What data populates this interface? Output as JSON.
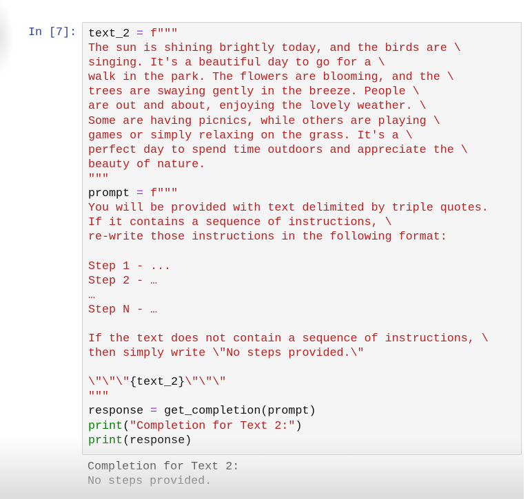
{
  "cell": {
    "prompt": "In [7]:",
    "lines": [
      [
        {
          "t": "text_2 ",
          "c": "n"
        },
        {
          "t": "=",
          "c": "op"
        },
        {
          "t": " f\"\"\"",
          "c": "str"
        }
      ],
      [
        {
          "t": "The sun is shining brightly today, and the birds are \\",
          "c": "str"
        }
      ],
      [
        {
          "t": "singing. It's a beautiful day to go for a \\",
          "c": "str"
        }
      ],
      [
        {
          "t": "walk in the park. The flowers are blooming, and the \\",
          "c": "str"
        }
      ],
      [
        {
          "t": "trees are swaying gently in the breeze. People \\",
          "c": "str"
        }
      ],
      [
        {
          "t": "are out and about, enjoying the lovely weather. \\",
          "c": "str"
        }
      ],
      [
        {
          "t": "Some are having picnics, while others are playing \\",
          "c": "str"
        }
      ],
      [
        {
          "t": "games or simply relaxing on the grass. It's a \\",
          "c": "str"
        }
      ],
      [
        {
          "t": "perfect day to spend time outdoors and appreciate the \\",
          "c": "str"
        }
      ],
      [
        {
          "t": "beauty of nature.",
          "c": "str"
        }
      ],
      [
        {
          "t": "\"\"\"",
          "c": "str"
        }
      ],
      [
        {
          "t": "prompt ",
          "c": "n"
        },
        {
          "t": "=",
          "c": "op"
        },
        {
          "t": " f\"\"\"",
          "c": "str"
        }
      ],
      [
        {
          "t": "You will be provided with text delimited by triple quotes.",
          "c": "str"
        }
      ],
      [
        {
          "t": "If it contains a sequence of instructions, \\",
          "c": "str"
        }
      ],
      [
        {
          "t": "re-write those instructions in the following format:",
          "c": "str"
        }
      ],
      [],
      [
        {
          "t": "Step 1 - ...",
          "c": "str"
        }
      ],
      [
        {
          "t": "Step 2 - …",
          "c": "str"
        }
      ],
      [
        {
          "t": "…",
          "c": "str"
        }
      ],
      [
        {
          "t": "Step N - …",
          "c": "str"
        }
      ],
      [],
      [
        {
          "t": "If the text does not contain a sequence of instructions, \\",
          "c": "str"
        }
      ],
      [
        {
          "t": "then simply write \\\"No steps provided.\\\"",
          "c": "str"
        }
      ],
      [],
      [
        {
          "t": "\\\"\\\"\\\"",
          "c": "str"
        },
        {
          "t": "{text_2}",
          "c": "n"
        },
        {
          "t": "\\\"\\\"\\\"",
          "c": "str"
        }
      ],
      [
        {
          "t": "\"\"\"",
          "c": "str"
        }
      ],
      [
        {
          "t": "response ",
          "c": "n"
        },
        {
          "t": "=",
          "c": "op"
        },
        {
          "t": " get_completion(prompt)",
          "c": "n"
        }
      ],
      [
        {
          "t": "print",
          "c": "fn"
        },
        {
          "t": "(",
          "c": "n"
        },
        {
          "t": "\"Completion for Text 2:\"",
          "c": "str"
        },
        {
          "t": ")",
          "c": "n"
        }
      ],
      [
        {
          "t": "print",
          "c": "fn"
        },
        {
          "t": "(response)",
          "c": "n"
        }
      ]
    ]
  },
  "output": {
    "lines": [
      "Completion for Text 2:",
      "No steps provided."
    ]
  },
  "colors": {
    "string": "#ba2121",
    "operator": "#aa22ff",
    "builtin": "#008000",
    "prompt": "#303f9f"
  }
}
